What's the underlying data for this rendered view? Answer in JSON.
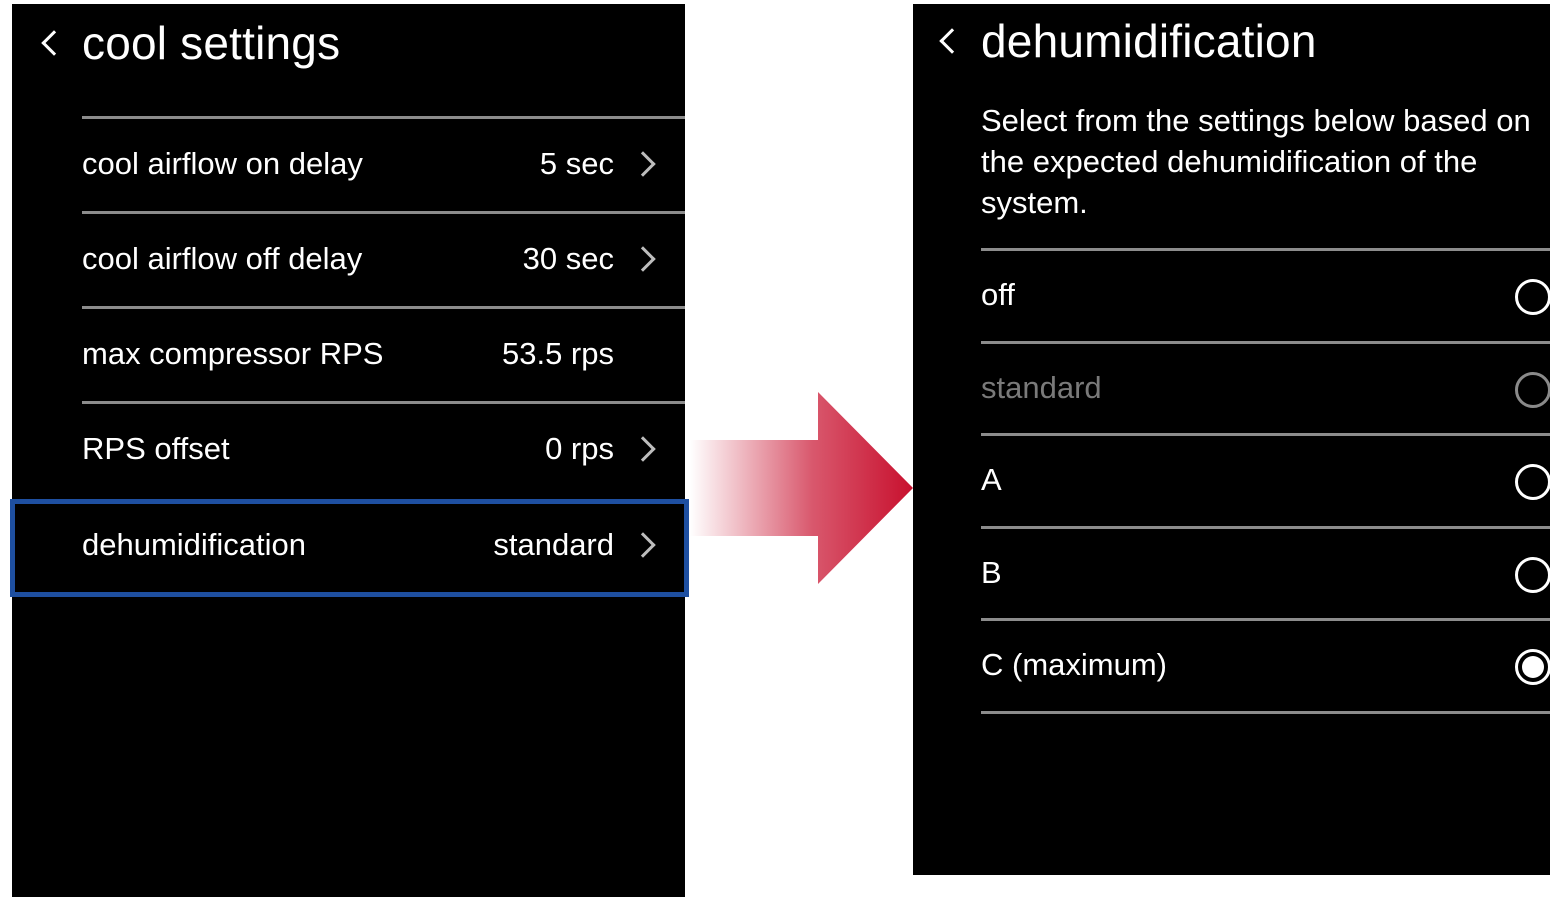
{
  "left_screen": {
    "title": "cool settings",
    "rows": [
      {
        "label": "cool airflow on delay",
        "value": "5 sec"
      },
      {
        "label": "cool airflow off delay",
        "value": "30 sec"
      },
      {
        "label": "max compressor RPS",
        "value": "53.5 rps"
      },
      {
        "label": "RPS offset",
        "value": "0 rps"
      },
      {
        "label": "dehumidification",
        "value": "standard"
      }
    ]
  },
  "right_screen": {
    "title": "dehumidification",
    "description": "Select from the settings below based on the expected dehumidification of the system.",
    "options": [
      {
        "label": "off"
      },
      {
        "label": "standard"
      },
      {
        "label": "A"
      },
      {
        "label": "B"
      },
      {
        "label": "C (maximum)"
      }
    ],
    "selected_option": "C (maximum)"
  },
  "colors": {
    "highlight_border": "#1e4fa0",
    "arrow": "#c8102e",
    "screen_background": "#000000"
  },
  "icons": [
    "back-chevron-icon",
    "chevron-right-icon",
    "radio-icon",
    "arrow-right-icon"
  ]
}
